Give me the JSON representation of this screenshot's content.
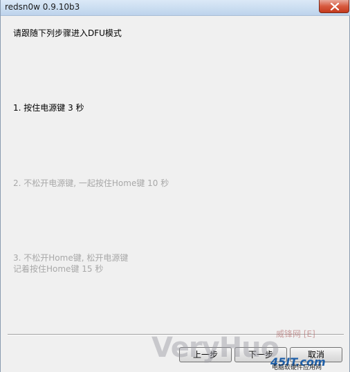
{
  "window": {
    "title": "redsn0w 0.9.10b3"
  },
  "content": {
    "heading": "请跟随下列步骤进入DFU模式",
    "step1": "1. 按住电源键 3 秒",
    "step2": "2. 不松开电源键, 一起按住Home键 10 秒",
    "step3_line1": "3. 不松开Home键, 松开电源键",
    "step3_line2": "记着按住Home键 15 秒"
  },
  "buttons": {
    "back": "上一步",
    "next": "下一步",
    "cancel": "取消"
  },
  "watermark": {
    "brand": "VeryHuo",
    "cn": "威锋网 [E]",
    "logo": "45IT.com",
    "logo_sub": "电脑软硬件应用网"
  },
  "icons": {
    "close": "close-icon"
  },
  "colors": {
    "active_text": "#000000",
    "inactive_text": "#a8a8a8",
    "close_button": "#d75a3f"
  }
}
